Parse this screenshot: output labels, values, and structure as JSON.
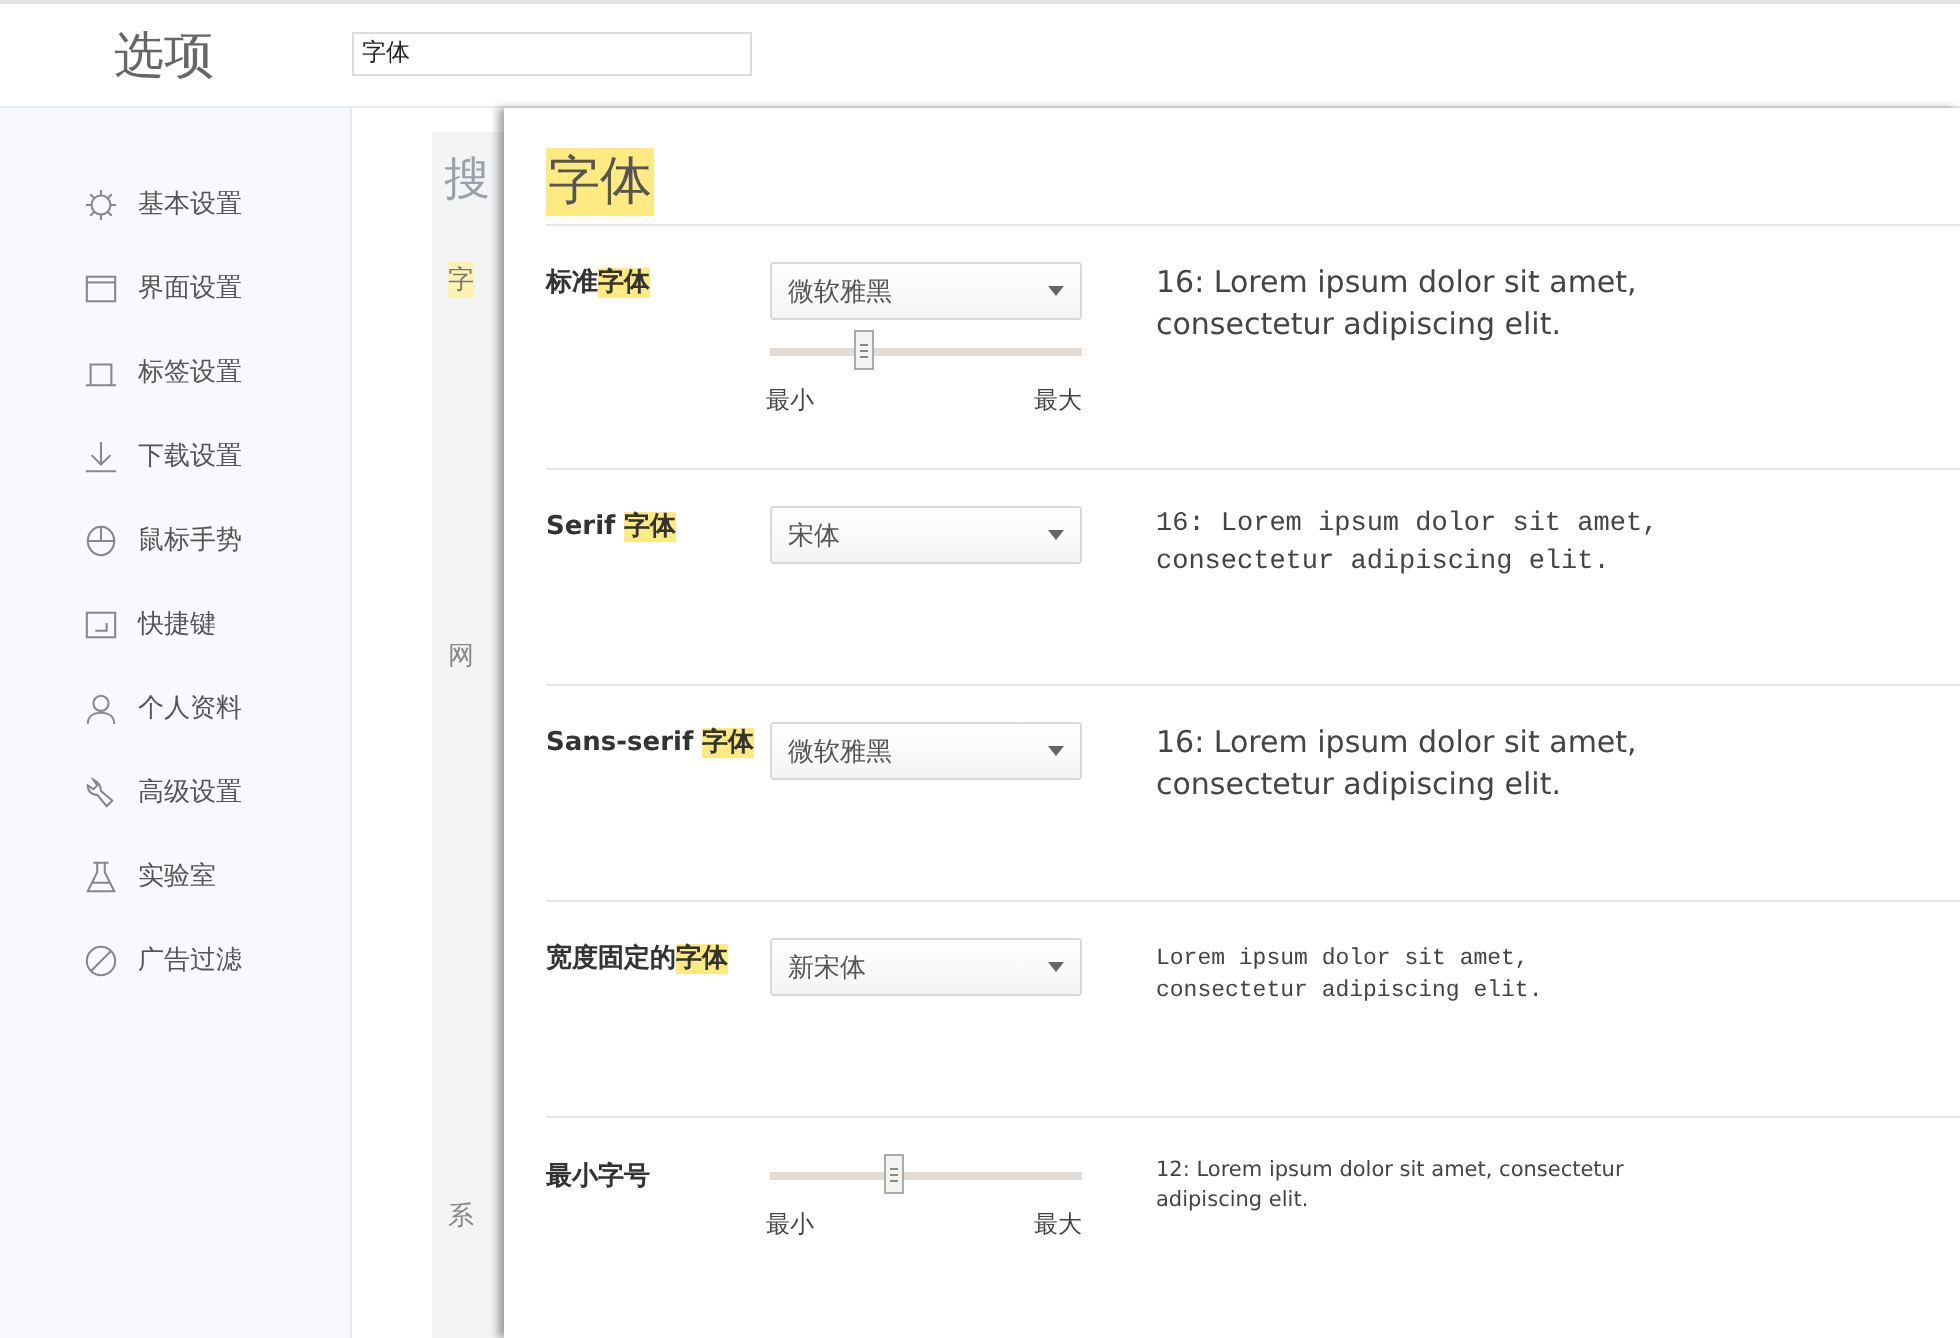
{
  "header": {
    "title": "选项",
    "search": {
      "value": "字体"
    }
  },
  "sidebar": {
    "items": [
      {
        "label": "基本设置",
        "selected": false
      },
      {
        "label": "界面设置",
        "selected": false
      },
      {
        "label": "标签设置",
        "selected": false
      },
      {
        "label": "下载设置",
        "selected": false
      },
      {
        "label": "鼠标手势",
        "selected": false
      },
      {
        "label": "快捷键",
        "selected": false
      },
      {
        "label": "个人资料",
        "selected": false
      },
      {
        "label": "高级设置",
        "selected": false
      },
      {
        "label": "实验室",
        "selected": false
      },
      {
        "label": "广告过滤",
        "selected": false
      }
    ]
  },
  "background_page": {
    "heading": "搜",
    "match": "字",
    "sections": [
      "网",
      "系"
    ]
  },
  "dialog": {
    "title": "字体",
    "rows": [
      {
        "kind": "standard",
        "label": "标准",
        "match": "字体",
        "select": "微软雅黑",
        "slider": {
          "level": 0.3,
          "min_label": "最小",
          "max_label": "最大"
        },
        "preview": "16: Lorem ipsum dolor sit amet, consectetur adipiscing elit."
      },
      {
        "kind": "serif",
        "label": "Serif ",
        "match": "字体",
        "select": "宋体",
        "preview": "16: Lorem ipsum dolor sit amet, consectetur adipiscing elit."
      },
      {
        "kind": "sans-serif",
        "label": "Sans-serif ",
        "match": "字体",
        "select": "微软雅黑",
        "preview": "16: Lorem ipsum dolor sit amet, consectetur adipiscing elit."
      },
      {
        "kind": "fixed",
        "label": "宽度固定的",
        "match": "字体",
        "select": "新宋体",
        "preview": "Lorem ipsum dolor sit amet, consectetur adipiscing elit."
      },
      {
        "kind": "minimum",
        "label": "最小字号",
        "slider": {
          "level": 0.4,
          "min_label": "最小",
          "max_label": "最大"
        },
        "preview": "12: Lorem ipsum dolor sit amet, consectetur adipiscing elit."
      }
    ]
  }
}
